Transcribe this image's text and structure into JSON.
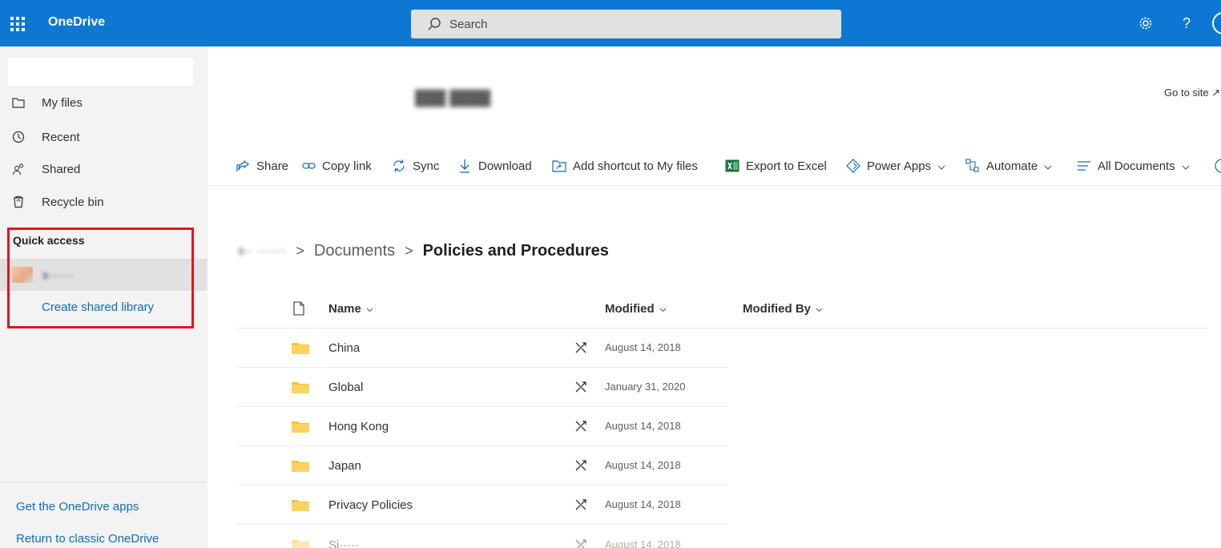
{
  "app": {
    "name": "OneDrive"
  },
  "search": {
    "placeholder": "Search"
  },
  "top_icons": [
    "gear-icon",
    "help-icon",
    "avatar"
  ],
  "nav": {
    "items": [
      {
        "label": "My files",
        "icon": "folder-icon"
      },
      {
        "label": "Recent",
        "icon": "clock-icon"
      },
      {
        "label": "Shared",
        "icon": "people-icon"
      },
      {
        "label": "Recycle bin",
        "icon": "recycle-bin-icon"
      }
    ],
    "quick_access_title": "Quick access",
    "quick_access_item": "s·······",
    "create_library": "Create shared library",
    "bottom_links": [
      "Get the OneDrive apps",
      "Return to classic OneDrive"
    ]
  },
  "site": {
    "title": "███ ████",
    "go_to_site": "Go to site ↗"
  },
  "commands": [
    {
      "label": "Share",
      "icon": "share-icon",
      "dropdown": false
    },
    {
      "label": "Copy link",
      "icon": "link-icon",
      "dropdown": false
    },
    {
      "label": "Sync",
      "icon": "sync-icon",
      "dropdown": false
    },
    {
      "label": "Download",
      "icon": "download-icon",
      "dropdown": false
    },
    {
      "label": "Add shortcut to My files",
      "icon": "add-shortcut-icon",
      "dropdown": false
    },
    {
      "label": "Export to Excel",
      "icon": "excel-icon",
      "dropdown": false
    },
    {
      "label": "Power Apps",
      "icon": "power-apps-icon",
      "dropdown": true
    },
    {
      "label": "Automate",
      "icon": "automate-icon",
      "dropdown": true
    },
    {
      "label": "All Documents",
      "icon": "view-list-icon",
      "dropdown": true
    }
  ],
  "breadcrumb": {
    "root": "s·· ·······",
    "middle": "Documents",
    "current": "Policies and Procedures",
    "separator": ">"
  },
  "list": {
    "columns": {
      "name": "Name",
      "modified": "Modified",
      "modified_by": "Modified By"
    },
    "rows": [
      {
        "name": "China",
        "modified": "August 14, 2018"
      },
      {
        "name": "Global",
        "modified": "January 31, 2020"
      },
      {
        "name": "Hong Kong",
        "modified": "August 14, 2018"
      },
      {
        "name": "Japan",
        "modified": "August 14, 2018"
      },
      {
        "name": "Privacy Policies",
        "modified": "August 14, 2018"
      },
      {
        "name": "Si·····",
        "modified": "August 14, 2018"
      }
    ]
  },
  "colors": {
    "suite_bar": "#0d78d4",
    "link": "#0f6cbd",
    "highlight": "#e8121b",
    "folder": "#f8c33a"
  }
}
